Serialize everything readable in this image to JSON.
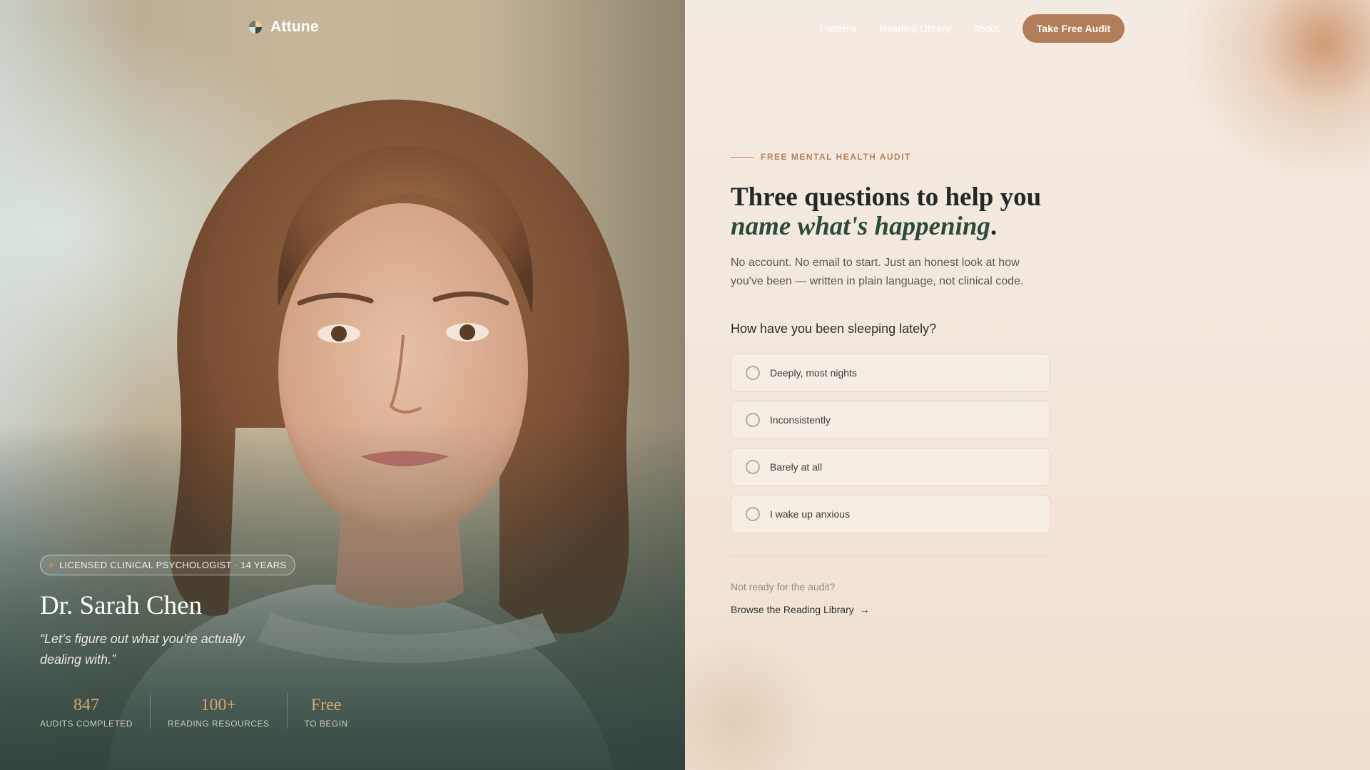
{
  "brand": {
    "name": "Attune"
  },
  "nav": {
    "links": [
      "Patterns",
      "Reading Library",
      "About"
    ],
    "cta_label": "Take Free Audit"
  },
  "profile": {
    "credential": "LICENSED CLINICAL PSYCHOLOGIST · 14 YEARS",
    "name": "Dr. Sarah Chen",
    "quote": "“Let’s figure out what you’re actually dealing with.”",
    "stats": [
      {
        "value": "847",
        "label": "AUDITS COMPLETED"
      },
      {
        "value": "100+",
        "label": "READING RESOURCES"
      },
      {
        "value": "Free",
        "label": "TO BEGIN"
      }
    ]
  },
  "audit": {
    "eyebrow": "FREE MENTAL HEALTH AUDIT",
    "headline_line1": "Three questions to help you",
    "headline_em": "name what's happening",
    "headline_end": ".",
    "subtitle": "No account. No email to start. Just an honest look at how you've been — written in plain language, not clinical code.",
    "question": "How have you been sleeping lately?",
    "options": [
      "Deeply, most nights",
      "Inconsistently",
      "Barely at all",
      "I wake up anxious"
    ],
    "not_ready": "Not ready for the audit?",
    "browse_label": "Browse the Reading Library",
    "browse_arrow": "→"
  },
  "colors": {
    "accent": "#b27d59",
    "headline_em": "#2d4a3a",
    "stat_value": "#d9a579"
  }
}
